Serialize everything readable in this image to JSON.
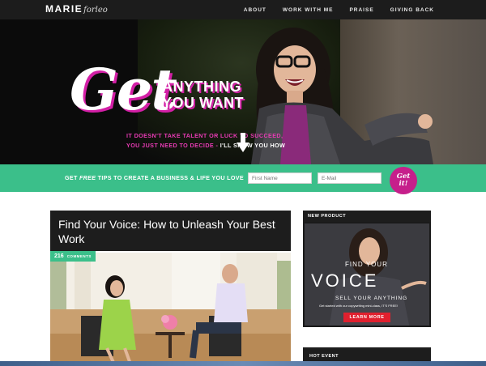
{
  "nav": {
    "logo_main": "MARIE",
    "logo_script": "forleo",
    "items": [
      "ABOUT",
      "WORK WITH ME",
      "PRAISE",
      "GIVING BACK"
    ]
  },
  "hero": {
    "headline": "Get",
    "subhead_line1": "ANYTHING",
    "subhead_line2": "YOU WANT",
    "tagline_line1": "IT DOESN'T TAKE TALENT OR LUCK TO SUCCEED,",
    "tagline_line2_pink": "YOU JUST NEED TO DECIDE - ",
    "tagline_line2_white": "I'LL SHOW YOU HOW"
  },
  "optin": {
    "label_prefix": "GET ",
    "label_em": "FREE",
    "label_suffix": " TIPS TO CREATE A BUSINESS & LIFE YOU LOVE",
    "first_name_placeholder": "First Name",
    "email_placeholder": "E-Mail",
    "button_line1": "Get",
    "button_line2": "it!"
  },
  "article": {
    "title": "Find Your Voice: How to Unleash Your Best Work",
    "comment_count": "216",
    "comment_word": "COMMENTS"
  },
  "sidebar": {
    "product_header": "NEW PRODUCT",
    "product_find": "FIND YOUR",
    "product_voice": "VOICE",
    "product_sell": "SELL YOUR ANYTHING",
    "product_tiny": "Get started with our copywriting mini-class, IT'S FREE!",
    "product_button": "LEARN MORE",
    "hot_header": "HOT EVENT"
  },
  "colors": {
    "accent_green": "#3bbf8a",
    "accent_pink": "#d31fa6",
    "nav_bg": "#1c1c1c",
    "learn_red": "#e0202e"
  }
}
